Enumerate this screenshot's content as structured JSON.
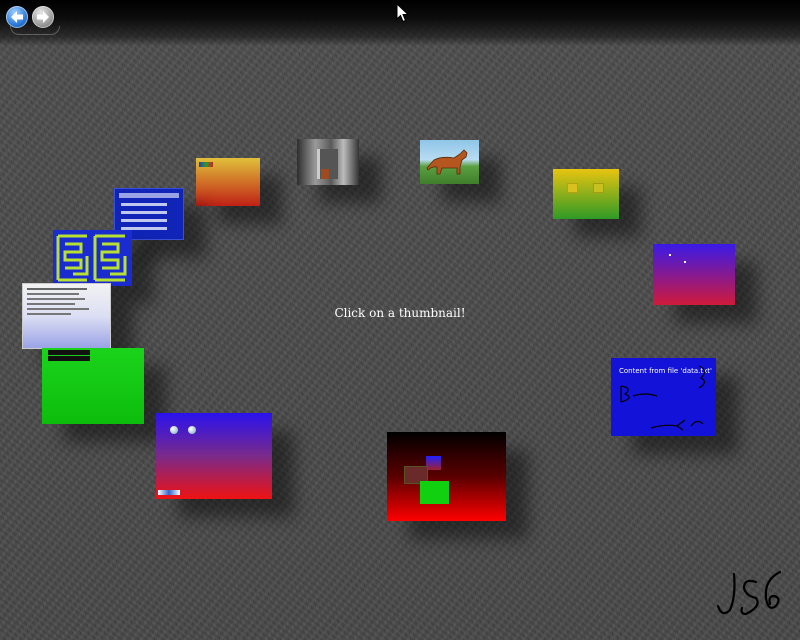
{
  "caption": "Click on a thumbnail!",
  "nav": {
    "back_icon": "back-arrow-icon",
    "forward_icon": "forward-arrow-icon"
  },
  "cursor_icon": "mouse-pointer-icon",
  "signature_icon": "jsg-signature",
  "thumbnails": {
    "content_file_text": "Content from file 'data.txt'"
  },
  "colors": {
    "background": "#4a4a4a",
    "caption": "#ffffff"
  }
}
